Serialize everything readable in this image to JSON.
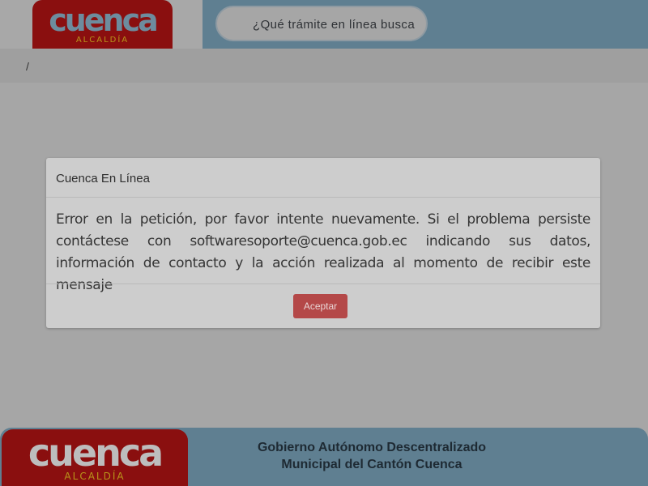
{
  "header": {
    "logo": {
      "word": "cuenca",
      "subtitle": "ALCALDÍA"
    },
    "search": {
      "placeholder": "¿Qué trámite en línea busca"
    }
  },
  "breadcrumb": {
    "separator": "/"
  },
  "modal": {
    "title": "Cuenca En Línea",
    "message": "Error en la petición, por favor intente nuevamente. Si el problema persiste contáctese con softwaresoporte@cuenca.gob.ec indicando sus datos, información de contacto y la acción realizada al momento de recibir este mensaje",
    "accept_label": "Aceptar"
  },
  "footer": {
    "logo": {
      "word": "cuenca",
      "subtitle": "ALCALDÍA"
    },
    "line1": "Gobierno Autónomo Descentralizado",
    "line2": "Municipal del Cantón Cuenca"
  },
  "colors": {
    "brand_red": "#8a0f0f",
    "brand_blue": "#5f7f91",
    "button_red": "#b44848",
    "overlay_gray": "#a6a6a6"
  }
}
